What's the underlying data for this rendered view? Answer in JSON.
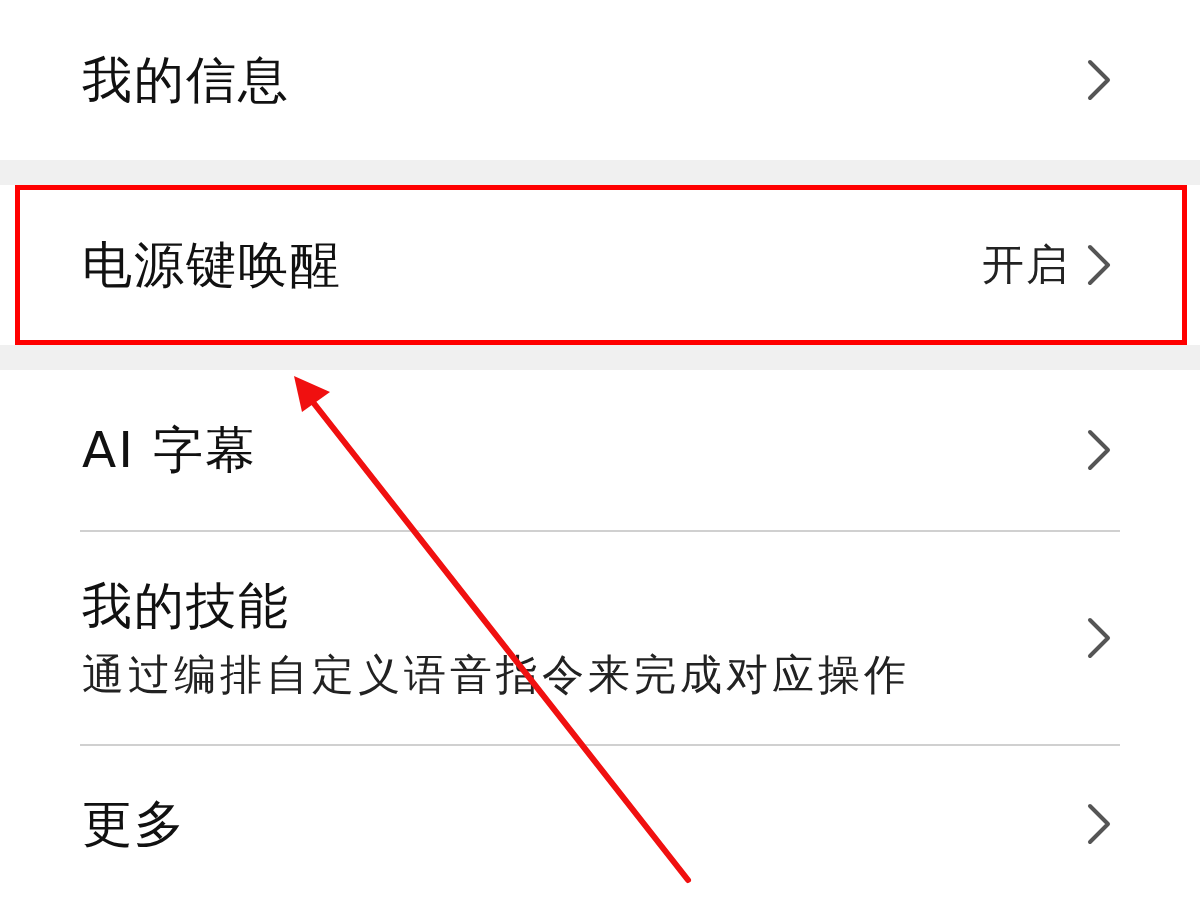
{
  "sections": [
    {
      "items": [
        {
          "title": "我的信息",
          "highlighted": false
        }
      ]
    },
    {
      "items": [
        {
          "title": "电源键唤醒",
          "value": "开启",
          "highlighted": true
        }
      ]
    },
    {
      "items": [
        {
          "title": "AI 字幕",
          "highlighted": false
        },
        {
          "title": "我的技能",
          "subtitle": "通过编排自定义语音指令来完成对应操作",
          "highlighted": false
        },
        {
          "title": "更多",
          "highlighted": false
        }
      ]
    }
  ]
}
